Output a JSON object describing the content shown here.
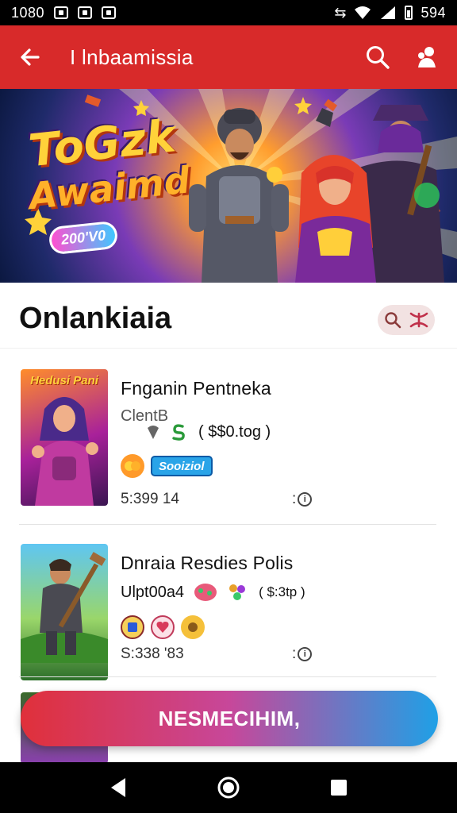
{
  "status_bar": {
    "time": "1080",
    "right_text": "594"
  },
  "app_bar": {
    "title": "I lnbaamissia",
    "back_icon": "arrow-left-icon",
    "search_icon": "search-icon",
    "account_icon": "account-icon"
  },
  "hero": {
    "title_line1": "ToGzk",
    "title_line2": "Awaimd",
    "badge_text": "200'V0"
  },
  "section": {
    "title": "Onlankiaia"
  },
  "items": [
    {
      "title": "Fnganin Pentneka",
      "label": "ClentB",
      "price": "( $$0.tog )",
      "thumb_label": "Hedusi Pani",
      "badge_pill": "Sooiziol",
      "meta": "5:399  14",
      "info": ":"
    },
    {
      "title": "Dnraia Resdies Polis",
      "label": "Ulpt00a4",
      "price": "( $:3tp )",
      "meta": "S:338  '83",
      "info": ":"
    }
  ],
  "cta": {
    "label": "NESMECIHIM,"
  },
  "colors": {
    "app_bar": "#d82a2a",
    "cta_start": "#e0303a",
    "cta_end": "#1fa0e6"
  }
}
